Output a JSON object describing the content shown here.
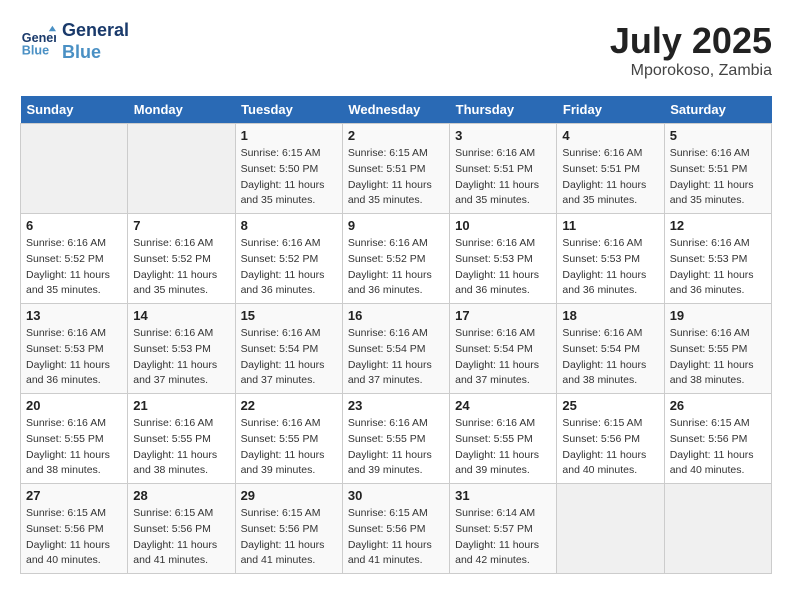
{
  "header": {
    "logo_line1": "General",
    "logo_line2": "Blue",
    "title": "July 2025",
    "subtitle": "Mporokoso, Zambia"
  },
  "days_of_week": [
    "Sunday",
    "Monday",
    "Tuesday",
    "Wednesday",
    "Thursday",
    "Friday",
    "Saturday"
  ],
  "weeks": [
    [
      {
        "day": "",
        "info": ""
      },
      {
        "day": "",
        "info": ""
      },
      {
        "day": "1",
        "info": "Sunrise: 6:15 AM\nSunset: 5:50 PM\nDaylight: 11 hours and 35 minutes."
      },
      {
        "day": "2",
        "info": "Sunrise: 6:15 AM\nSunset: 5:51 PM\nDaylight: 11 hours and 35 minutes."
      },
      {
        "day": "3",
        "info": "Sunrise: 6:16 AM\nSunset: 5:51 PM\nDaylight: 11 hours and 35 minutes."
      },
      {
        "day": "4",
        "info": "Sunrise: 6:16 AM\nSunset: 5:51 PM\nDaylight: 11 hours and 35 minutes."
      },
      {
        "day": "5",
        "info": "Sunrise: 6:16 AM\nSunset: 5:51 PM\nDaylight: 11 hours and 35 minutes."
      }
    ],
    [
      {
        "day": "6",
        "info": "Sunrise: 6:16 AM\nSunset: 5:52 PM\nDaylight: 11 hours and 35 minutes."
      },
      {
        "day": "7",
        "info": "Sunrise: 6:16 AM\nSunset: 5:52 PM\nDaylight: 11 hours and 35 minutes."
      },
      {
        "day": "8",
        "info": "Sunrise: 6:16 AM\nSunset: 5:52 PM\nDaylight: 11 hours and 36 minutes."
      },
      {
        "day": "9",
        "info": "Sunrise: 6:16 AM\nSunset: 5:52 PM\nDaylight: 11 hours and 36 minutes."
      },
      {
        "day": "10",
        "info": "Sunrise: 6:16 AM\nSunset: 5:53 PM\nDaylight: 11 hours and 36 minutes."
      },
      {
        "day": "11",
        "info": "Sunrise: 6:16 AM\nSunset: 5:53 PM\nDaylight: 11 hours and 36 minutes."
      },
      {
        "day": "12",
        "info": "Sunrise: 6:16 AM\nSunset: 5:53 PM\nDaylight: 11 hours and 36 minutes."
      }
    ],
    [
      {
        "day": "13",
        "info": "Sunrise: 6:16 AM\nSunset: 5:53 PM\nDaylight: 11 hours and 36 minutes."
      },
      {
        "day": "14",
        "info": "Sunrise: 6:16 AM\nSunset: 5:53 PM\nDaylight: 11 hours and 37 minutes."
      },
      {
        "day": "15",
        "info": "Sunrise: 6:16 AM\nSunset: 5:54 PM\nDaylight: 11 hours and 37 minutes."
      },
      {
        "day": "16",
        "info": "Sunrise: 6:16 AM\nSunset: 5:54 PM\nDaylight: 11 hours and 37 minutes."
      },
      {
        "day": "17",
        "info": "Sunrise: 6:16 AM\nSunset: 5:54 PM\nDaylight: 11 hours and 37 minutes."
      },
      {
        "day": "18",
        "info": "Sunrise: 6:16 AM\nSunset: 5:54 PM\nDaylight: 11 hours and 38 minutes."
      },
      {
        "day": "19",
        "info": "Sunrise: 6:16 AM\nSunset: 5:55 PM\nDaylight: 11 hours and 38 minutes."
      }
    ],
    [
      {
        "day": "20",
        "info": "Sunrise: 6:16 AM\nSunset: 5:55 PM\nDaylight: 11 hours and 38 minutes."
      },
      {
        "day": "21",
        "info": "Sunrise: 6:16 AM\nSunset: 5:55 PM\nDaylight: 11 hours and 38 minutes."
      },
      {
        "day": "22",
        "info": "Sunrise: 6:16 AM\nSunset: 5:55 PM\nDaylight: 11 hours and 39 minutes."
      },
      {
        "day": "23",
        "info": "Sunrise: 6:16 AM\nSunset: 5:55 PM\nDaylight: 11 hours and 39 minutes."
      },
      {
        "day": "24",
        "info": "Sunrise: 6:16 AM\nSunset: 5:55 PM\nDaylight: 11 hours and 39 minutes."
      },
      {
        "day": "25",
        "info": "Sunrise: 6:15 AM\nSunset: 5:56 PM\nDaylight: 11 hours and 40 minutes."
      },
      {
        "day": "26",
        "info": "Sunrise: 6:15 AM\nSunset: 5:56 PM\nDaylight: 11 hours and 40 minutes."
      }
    ],
    [
      {
        "day": "27",
        "info": "Sunrise: 6:15 AM\nSunset: 5:56 PM\nDaylight: 11 hours and 40 minutes."
      },
      {
        "day": "28",
        "info": "Sunrise: 6:15 AM\nSunset: 5:56 PM\nDaylight: 11 hours and 41 minutes."
      },
      {
        "day": "29",
        "info": "Sunrise: 6:15 AM\nSunset: 5:56 PM\nDaylight: 11 hours and 41 minutes."
      },
      {
        "day": "30",
        "info": "Sunrise: 6:15 AM\nSunset: 5:56 PM\nDaylight: 11 hours and 41 minutes."
      },
      {
        "day": "31",
        "info": "Sunrise: 6:14 AM\nSunset: 5:57 PM\nDaylight: 11 hours and 42 minutes."
      },
      {
        "day": "",
        "info": ""
      },
      {
        "day": "",
        "info": ""
      }
    ]
  ]
}
